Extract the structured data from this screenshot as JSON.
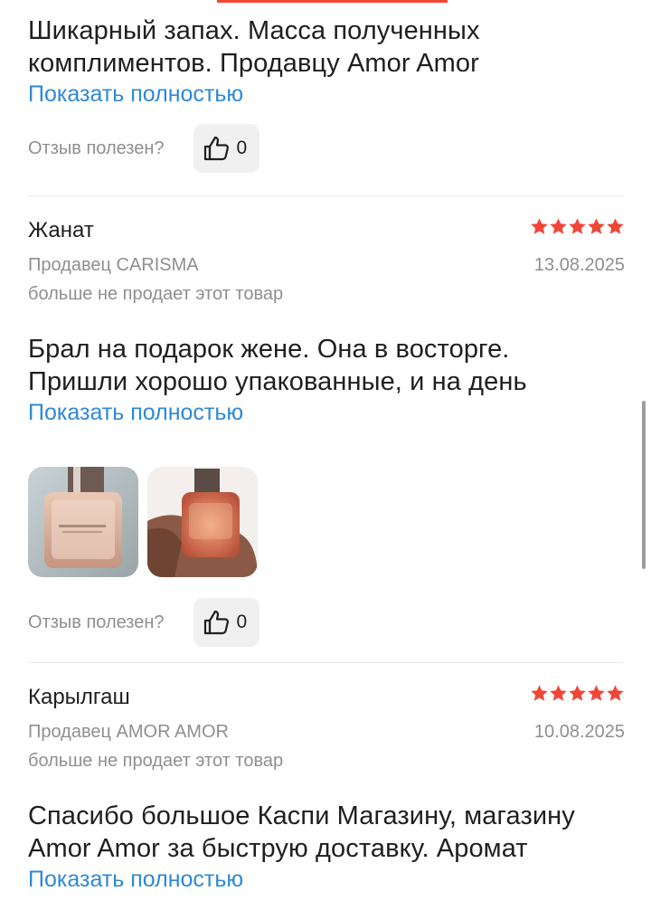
{
  "colors": {
    "accent": "#f14635",
    "link": "#2f88d6",
    "muted": "#8f8f8f",
    "star": "#f14635"
  },
  "reviews": [
    {
      "text_lines": [
        "Шикарный запах. Масса полученных",
        "комплиментов. Продавцу Amor Amor"
      ],
      "show_more": "Показать полностью",
      "helpful_label": "Отзыв полезен?",
      "likes": "0"
    },
    {
      "author": "Жанат",
      "rating": 5,
      "seller": "Продавец CARISMA",
      "date": "13.08.2025",
      "not_sold": "больше не продает этот товар",
      "text_lines": [
        "Брал на подарок жене. Она в восторге.",
        "Пришли хорошо упакованные, и на день"
      ],
      "show_more": "Показать полностью",
      "photos": [
        "perfume-bottle-photo",
        "perfume-in-hand-photo"
      ],
      "helpful_label": "Отзыв полезен?",
      "likes": "0"
    },
    {
      "author": "Карылгаш",
      "rating": 5,
      "seller": "Продавец AMOR AMOR",
      "date": "10.08.2025",
      "not_sold": "больше не продает этот товар",
      "text_lines": [
        "Спасибо большое Каспи Магазину, магазину",
        "Amor Amor за быструю доставку. Аромат"
      ],
      "show_more": "Показать полностью"
    }
  ],
  "icons": {
    "like": "thumbs-up-icon",
    "star": "star-icon"
  }
}
